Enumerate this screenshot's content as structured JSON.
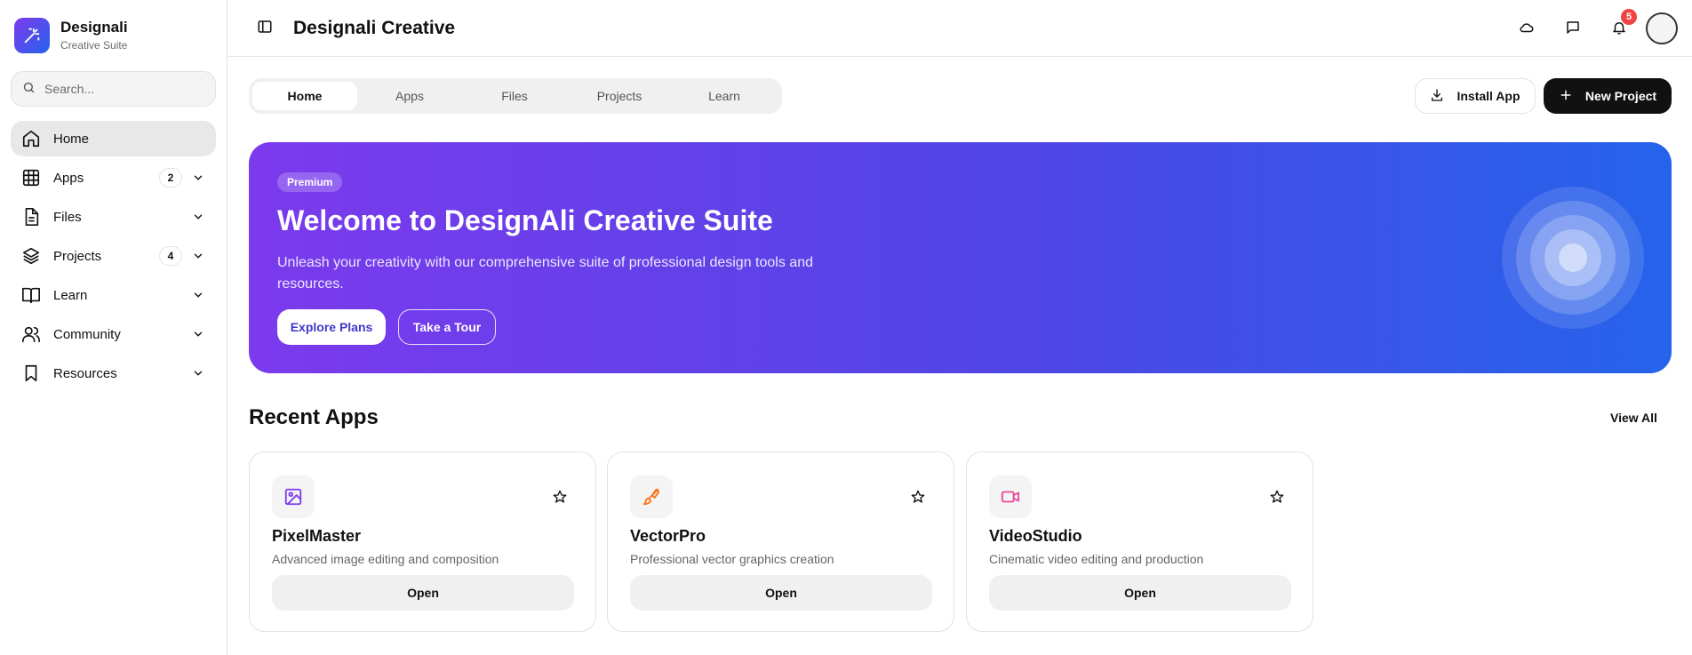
{
  "brand": {
    "title": "Designali",
    "subtitle": "Creative Suite"
  },
  "search": {
    "placeholder": "Search..."
  },
  "sidebar": {
    "items": [
      {
        "label": "Home",
        "icon": "home-icon",
        "active": true
      },
      {
        "label": "Apps",
        "icon": "grid-icon",
        "badge": "2"
      },
      {
        "label": "Files",
        "icon": "file-icon"
      },
      {
        "label": "Projects",
        "icon": "layers-icon",
        "badge": "4"
      },
      {
        "label": "Learn",
        "icon": "book-icon"
      },
      {
        "label": "Community",
        "icon": "users-icon"
      },
      {
        "label": "Resources",
        "icon": "bookmark-icon"
      }
    ]
  },
  "header": {
    "title": "Designali Creative",
    "notification_count": "5"
  },
  "tabs": [
    {
      "label": "Home",
      "active": true
    },
    {
      "label": "Apps"
    },
    {
      "label": "Files"
    },
    {
      "label": "Projects"
    },
    {
      "label": "Learn"
    }
  ],
  "actions": {
    "install_label": "Install App",
    "new_project_label": "New Project"
  },
  "hero": {
    "badge": "Premium",
    "title": "Welcome to DesignAli Creative Suite",
    "description": "Unleash your creativity with our comprehensive suite of professional design tools and resources.",
    "primary_button": "Explore Plans",
    "secondary_button": "Take a Tour"
  },
  "recent_apps": {
    "title": "Recent Apps",
    "view_all": "View All",
    "items": [
      {
        "name": "PixelMaster",
        "description": "Advanced image editing and composition",
        "open_label": "Open",
        "icon": "image-icon",
        "color": "#7c3aed"
      },
      {
        "name": "VectorPro",
        "description": "Professional vector graphics creation",
        "open_label": "Open",
        "icon": "brush-icon",
        "color": "#f97316"
      },
      {
        "name": "VideoStudio",
        "description": "Cinematic video editing and production",
        "open_label": "Open",
        "icon": "video-icon",
        "color": "#ec4899"
      }
    ]
  },
  "colors": {
    "accent_purple": "#7c3aed",
    "accent_blue": "#2563eb",
    "notification": "#ef4444"
  }
}
